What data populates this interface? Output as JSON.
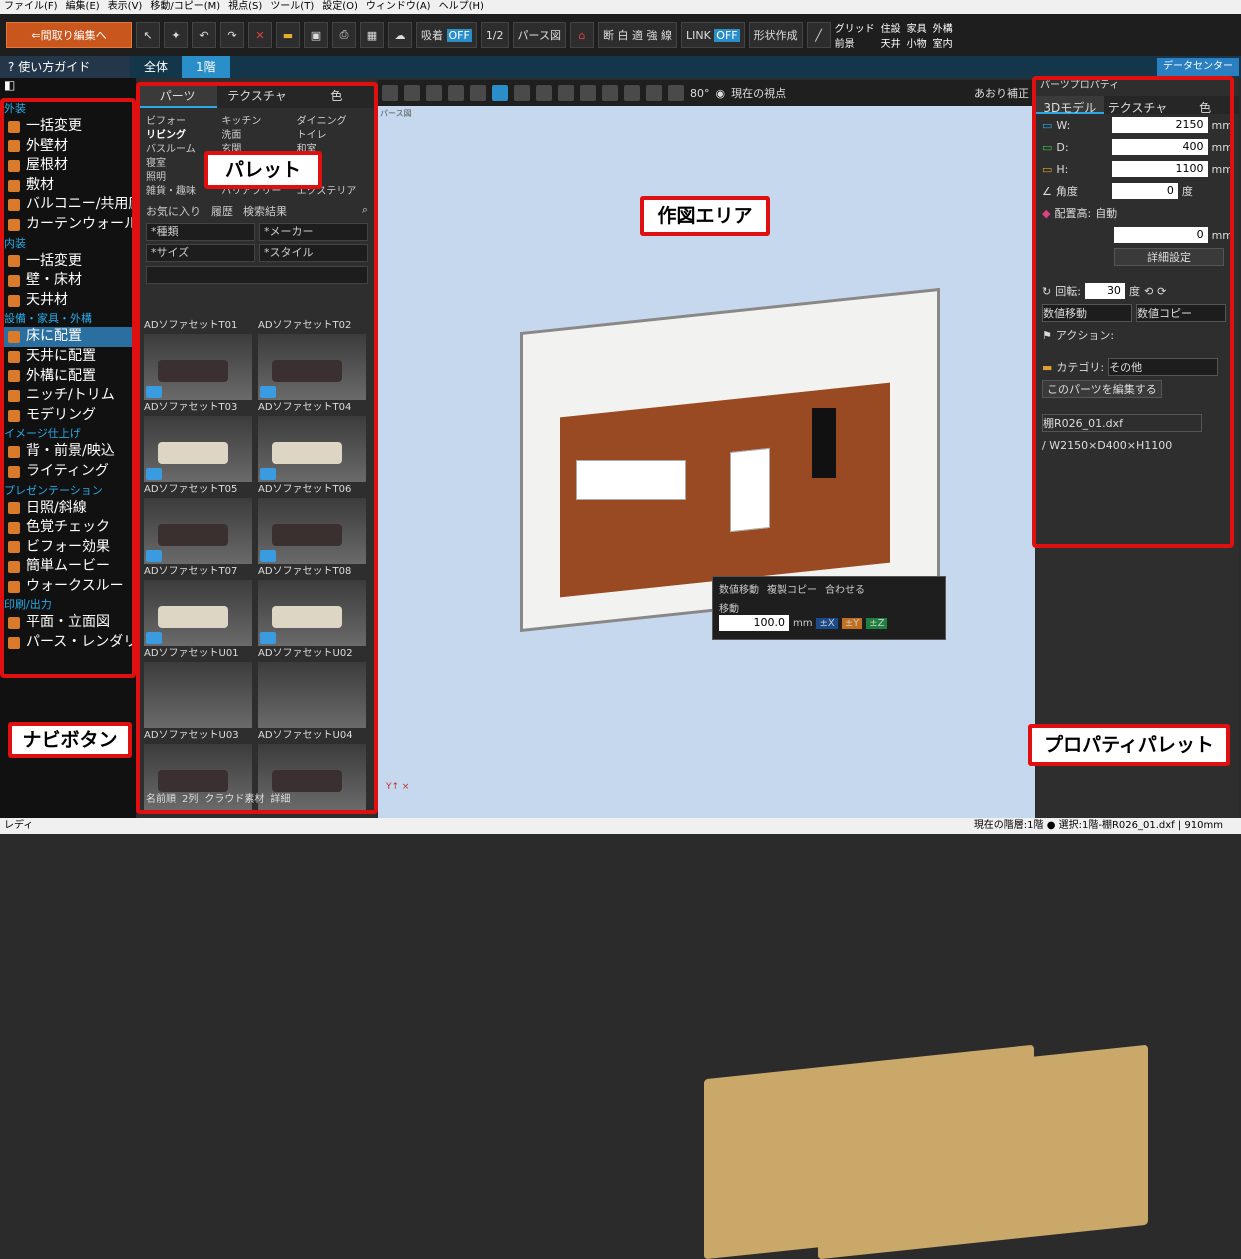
{
  "menu": [
    "ファイル(F)",
    "編集(E)",
    "表示(V)",
    "移動/コピー(M)",
    "視点(S)",
    "ツール(T)",
    "設定(O)",
    "ウィンドウ(A)",
    "ヘルプ(H)"
  ],
  "toolbar": {
    "back_label": "間取り編集へ",
    "snap_label": "吸着",
    "snap_state": "OFF",
    "scale_label": "1/2",
    "view_mode": "パース図",
    "section_labels": "断 白 適 強 線",
    "link_label": "LINK",
    "link_state": "OFF",
    "shape_label": "形状作成",
    "checks": [
      "グリッド",
      "住設",
      "家具",
      "外構",
      "前景",
      "天井",
      "小物",
      "室内"
    ]
  },
  "tabs": {
    "guide": "使い方ガイド",
    "all": "全体",
    "floor1": "1階",
    "datacenter": "データセンター"
  },
  "nav": {
    "callout": "ナビボタン",
    "sections": [
      {
        "title": "外装",
        "items": [
          "一括変更",
          "外壁材",
          "屋根材",
          "敷材",
          "バルコニー/共用廊下",
          "カーテンウォール"
        ]
      },
      {
        "title": "内装",
        "items": [
          "一括変更",
          "壁・床材",
          "天井材"
        ]
      },
      {
        "title": "設備・家具・外構",
        "items": [
          "床に配置",
          "天井に配置",
          "外構に配置",
          "ニッチ/トリム",
          "モデリング"
        ]
      },
      {
        "title": "イメージ仕上げ",
        "items": [
          "背・前景/映込",
          "ライティング"
        ]
      },
      {
        "title": "プレゼンテーション",
        "items": [
          "日照/斜線",
          "色覚チェック",
          "ビフォー効果",
          "簡単ムービー",
          "ウォークスルー"
        ]
      },
      {
        "title": "印刷/出力",
        "items": [
          "平面・立面図",
          "パース・レンダリング"
        ]
      }
    ],
    "selected": "床に配置"
  },
  "palette": {
    "callout": "パレット",
    "tabs": [
      "パーツ",
      "テクスチャ",
      "色"
    ],
    "categories": [
      "ビフォー",
      "キッチン",
      "ダイニング",
      "リビング",
      "洗面",
      "トイレ",
      "バスルーム",
      "玄関",
      "和室",
      "寝室",
      "",
      "",
      "照明",
      "",
      "",
      "雑貨・趣味",
      "バリアフリー",
      "エクステリア"
    ],
    "selected_category": "リビング",
    "fav": "お気に入り",
    "history": "履歴",
    "results": "検索結果",
    "filters": [
      "*種類",
      "*メーカー",
      "*サイズ",
      "*スタイル"
    ],
    "items": [
      {
        "label": "ADソファセットT01",
        "style": "dark"
      },
      {
        "label": "ADソファセットT02",
        "style": "dark"
      },
      {
        "label": "ADソファセットT03",
        "style": "light"
      },
      {
        "label": "ADソファセットT04",
        "style": "light"
      },
      {
        "label": "ADソファセットT05",
        "style": "dark"
      },
      {
        "label": "ADソファセットT06",
        "style": "dark"
      },
      {
        "label": "ADソファセットT07",
        "style": "light"
      },
      {
        "label": "ADソファセットT08",
        "style": "light"
      },
      {
        "label": "ADソファセットU01",
        "style": "wood"
      },
      {
        "label": "ADソファセットU02",
        "style": "wood"
      },
      {
        "label": "ADソファセットU03",
        "style": "dark"
      },
      {
        "label": "ADソファセットU04",
        "style": "dark"
      }
    ],
    "sort": "名前順",
    "columns": "2列",
    "cloud": "クラウド素材",
    "detail": "詳細"
  },
  "view": {
    "angle": "80°",
    "current_view": "現在の視点",
    "tilt": "あおり補正",
    "area_tag": "パース図",
    "callout": "作図エリア",
    "move": {
      "opt1": "数値移動",
      "opt2": "複製コピー",
      "opt3": "合わせる",
      "label": "移動",
      "value": "100.0",
      "unit": "mm"
    }
  },
  "props": {
    "title": "パーツプロパティ",
    "tabs": [
      "3Dモデル",
      "テクスチャ",
      "色"
    ],
    "w_label": "W:",
    "w": "2150",
    "d_label": "D:",
    "d": "400",
    "h_label": "H:",
    "h": "1100",
    "unit": "mm",
    "angle_label": "角度",
    "angle": "0",
    "angle_unit": "度",
    "height_label": "配置高:",
    "auto": "自動",
    "height": "0",
    "detail_btn": "詳細設定",
    "rotate_label": "回転:",
    "rotate": "30",
    "rotate_unit": "度",
    "move_select": "数値移動",
    "copy_select": "数値コピー",
    "action_label": "アクション:",
    "category_label": "カテゴリ:",
    "category": "その他",
    "edit_btn": "このパーツを編集する",
    "file": "棚R026_01.dxf",
    "dims": "/ W2150×D400×H1100",
    "callout": "プロパティパレット"
  },
  "status": {
    "left": "レディ",
    "right": "現在の階層:1階 ● 選択:1階-棚R026_01.dxf | 910mm"
  }
}
